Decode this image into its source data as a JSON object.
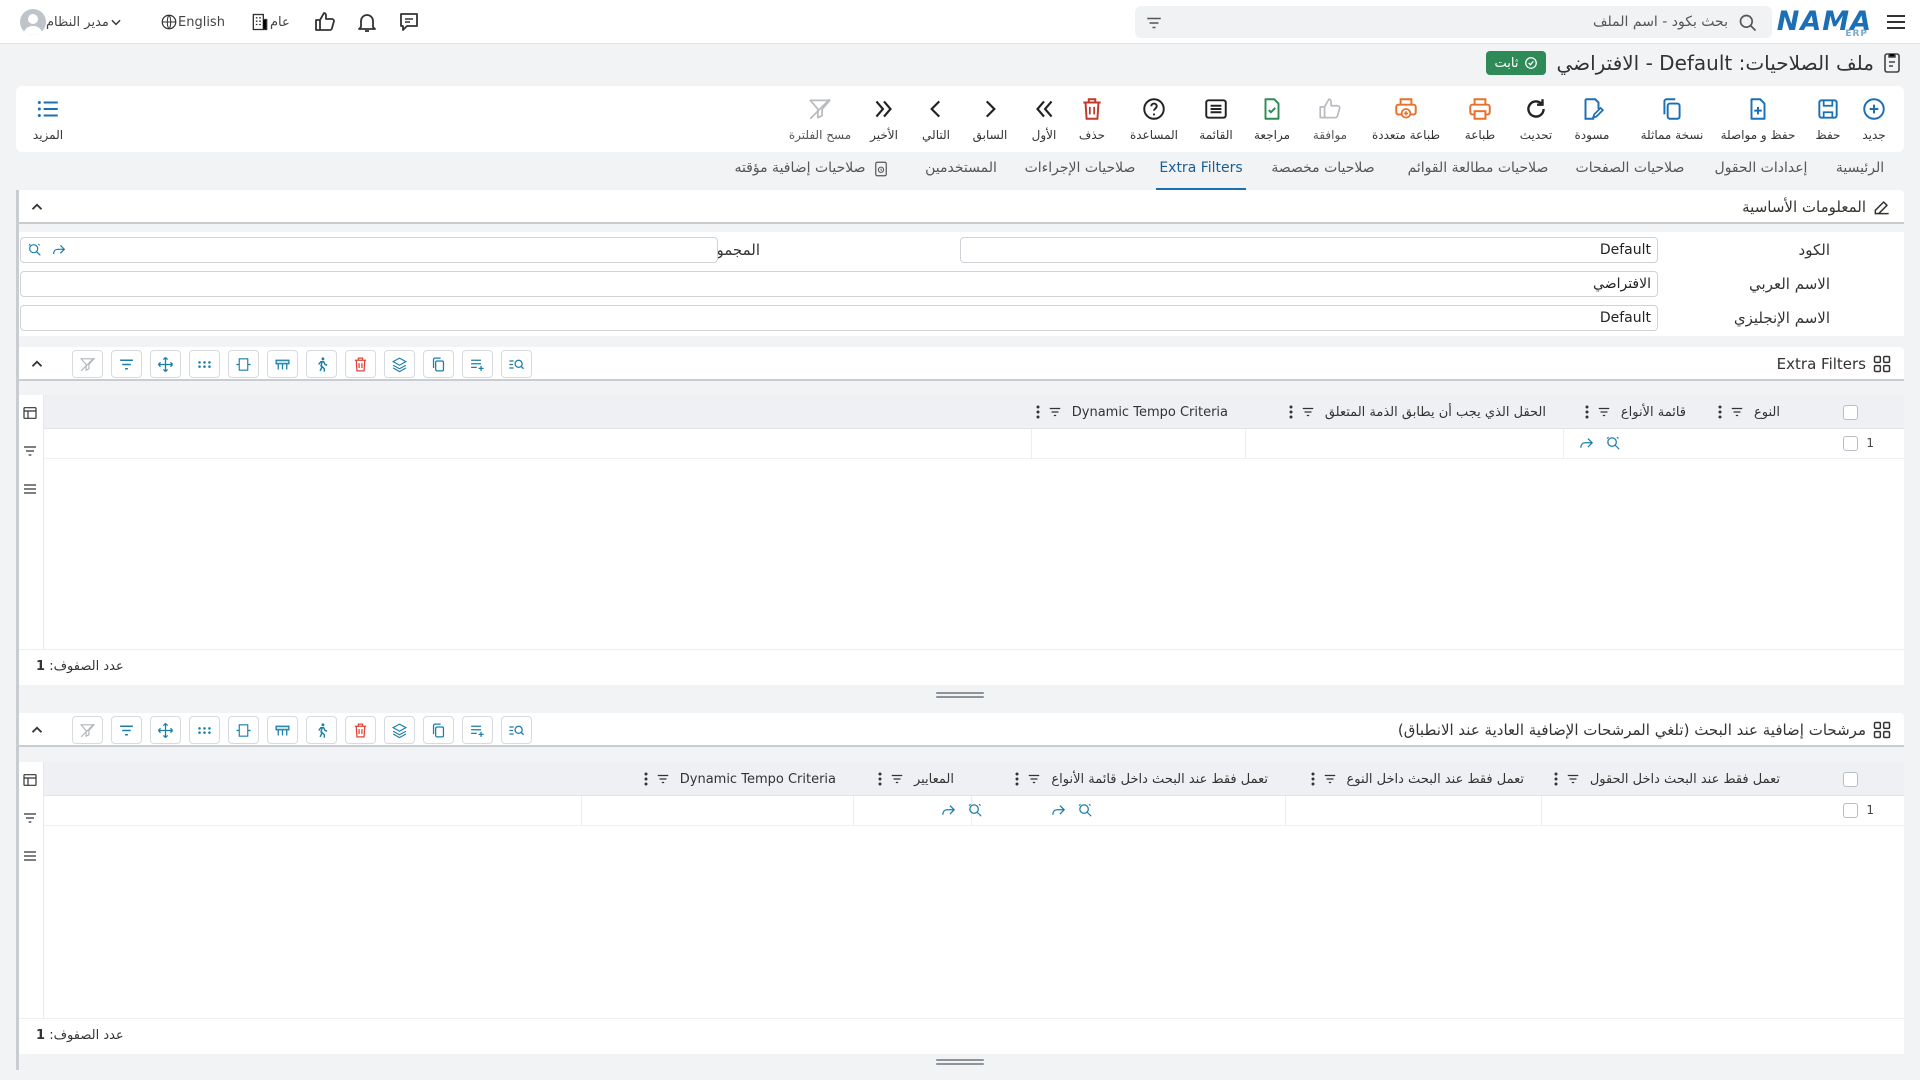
{
  "topbar": {
    "logo": "NAMA",
    "logo_sub": "ERP",
    "search_placeholder": "بحث بكود - اسم الملف",
    "user_name": "مدير النظام",
    "language": "English",
    "branch": "عام",
    "icons": [
      "menu-icon",
      "search-icon",
      "filter-icon",
      "chat-icon",
      "bell-icon",
      "thumbs-up-icon",
      "building-icon",
      "globe-icon",
      "user-avatar-icon",
      "chevron-down-icon"
    ]
  },
  "page": {
    "title": "ملف الصلاحيات: Default - الافتراضي",
    "status": "ثابت",
    "status_color": "#2e8b57"
  },
  "toolbar": {
    "new": "جديد",
    "save": "حفظ",
    "save_continue": "حفظ و مواصلة",
    "duplicate": "نسخة مماثلة",
    "draft": "مسودة",
    "refresh": "تحديث",
    "print": "طباعة",
    "multi_print": "طباعة متعددة",
    "approve": "موافقة",
    "review": "مراجعة",
    "list": "القائمة",
    "help": "المساعدة",
    "delete": "حذف",
    "first": "الأول",
    "previous": "السابق",
    "next": "التالي",
    "last": "الأخير",
    "clear_filter": "مسح الفلترة",
    "more": "المزيد"
  },
  "tabs": {
    "home": "الرئيسية",
    "field_settings": "إعدادات الحقول",
    "page_permissions": "صلاحيات الصفحات",
    "list_review_permissions": "صلاحيات مطالعة القوائم",
    "custom_permissions": "صلاحيات مخصصة",
    "extra_filters": "Extra Filters",
    "action_permissions": "صلاحيات الإجراءات",
    "users": "المستخدمين",
    "temporary_permissions": "صلاحيات إضافية مؤقته",
    "active": "extra_filters"
  },
  "basic_info": {
    "title": "المعلومات الأساسية",
    "code_label": "الكود",
    "code_value": "Default",
    "group_label": "المجموعة",
    "group_value": "",
    "arabic_name_label": "الاسم العربي",
    "arabic_name_value": "الافتراضي",
    "english_name_label": "الاسم الإنجليزي",
    "english_name_value": "Default"
  },
  "extra_filters_grid": {
    "title": "Extra Filters",
    "columns": {
      "type": "النوع",
      "types_list": "قائمة الأنواع",
      "field_match": "الحقل الذي يجب أن يطابق الذمة المتعلق",
      "dynamic_tempo": "Dynamic Tempo Criteria"
    },
    "rows": [
      {
        "num": "1"
      }
    ],
    "row_count_label": "عدد الصفوف:",
    "row_count": "1"
  },
  "search_filters_grid": {
    "title": "مرشحات إضافية عند البحث (تلغي المرشحات الإضافية العادية عند الانطباق)",
    "columns": {
      "in_fields": "تعمل فقط عند البحث داخل الحقول",
      "in_type": "تعمل فقط عند البحث داخل النوع",
      "in_types_list": "تعمل فقط عند البحث داخل قائمة الأنواع",
      "criteria": "المعايير",
      "dynamic_tempo": "Dynamic Tempo Criteria"
    },
    "rows": [
      {
        "num": "1"
      }
    ],
    "row_count_label": "عدد الصفوف:",
    "row_count": "1"
  },
  "colors": {
    "accent": "#1b6fb5",
    "icon_teal": "#1a7ea8",
    "delete_red": "#c0392b",
    "print_orange": "#e8702a",
    "review_green": "#2e8b57"
  }
}
